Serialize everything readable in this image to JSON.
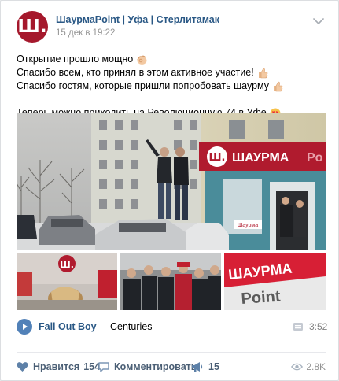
{
  "post": {
    "author": "ШаурмаPoint | Уфа | Стерлитамак",
    "date": "15 дек в 19:22",
    "avatar_letter": "Ш.",
    "lines": [
      "Открытие прошло мощно",
      "Спасибо всем, кто принял в этом активное участие!",
      "Спасибо гостям, которые пришли попробовать шаурму",
      "Теперь можно приходить на Революционную 74 в Уфе"
    ]
  },
  "photo": {
    "sign_text": "ШАУРМА",
    "sign_suffix": "Po",
    "sign_logo": "Ш.",
    "small_sign": "Шаурма"
  },
  "thumbs": {
    "logo": "Ш.",
    "wall_top": "ШАУРМА",
    "wall_bottom": "Point"
  },
  "audio": {
    "artist": "Fall Out Boy",
    "separator": "–",
    "title": "Centuries",
    "duration": "3:52"
  },
  "actions": {
    "like_label": "Нравится",
    "like_count": "154",
    "comment_label": "Комментировать",
    "share_count": "15",
    "views": "2.8K"
  },
  "colors": {
    "brand": "#a5182c",
    "link": "#2a5885",
    "action": "#5181b8"
  }
}
